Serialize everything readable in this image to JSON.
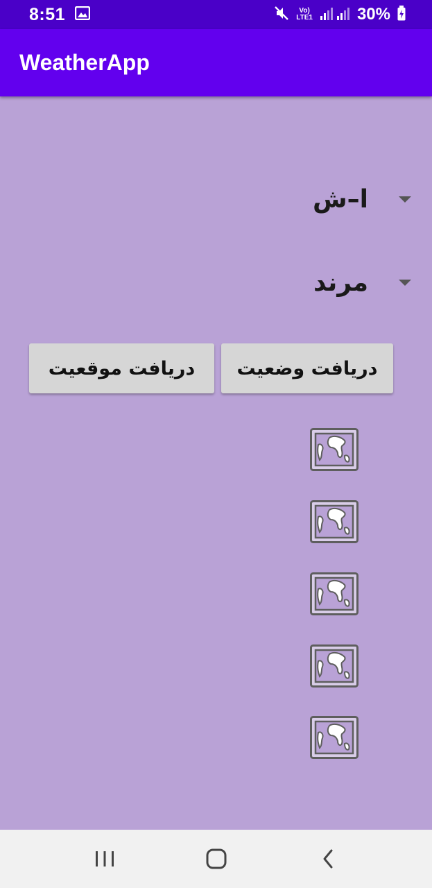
{
  "status_bar": {
    "time": "8:51",
    "lte_top": "Vo)",
    "lte_bottom": "LTE1",
    "battery": "30%",
    "icons": [
      "gallery-icon",
      "mute-icon",
      "signal-icon",
      "battery-charging-icon"
    ]
  },
  "app_bar": {
    "title": "WeatherApp"
  },
  "spinners": [
    {
      "value": "ا–ش"
    },
    {
      "value": "مرند"
    }
  ],
  "buttons": {
    "get_status": "دریافت وضعیت",
    "get_location": "دریافت موقعیت"
  },
  "image_placeholders": {
    "count": 5,
    "icon": "image-placeholder-icon"
  },
  "nav_bar": {
    "icons": [
      "recents-icon",
      "home-icon",
      "back-icon"
    ]
  },
  "colors": {
    "status_bar": "#4a00c8",
    "app_bar": "#6200ee",
    "background": "#b9a2d6",
    "button": "#d6d6d6"
  }
}
